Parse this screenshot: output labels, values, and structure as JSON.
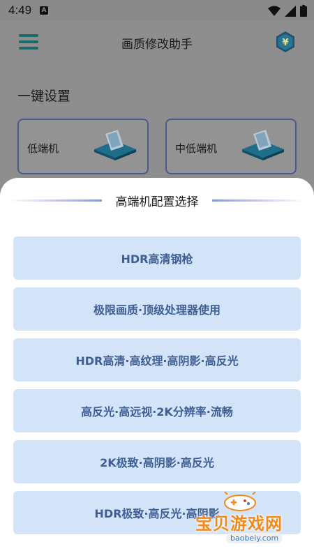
{
  "status_bar": {
    "time": "4:49",
    "notif_glyph": "A",
    "icons": [
      "wifi-icon",
      "signal-icon",
      "battery-icon"
    ]
  },
  "app": {
    "title": "画质修改助手",
    "menu_icon": "menu-icon",
    "right_icon": "yen-icon",
    "section_title": "一键设置",
    "tiers": [
      {
        "label": "低端机"
      },
      {
        "label": "中低端机"
      }
    ]
  },
  "sheet": {
    "title": "高端机配置选择",
    "options": [
      "HDR高清钢枪",
      "极限画质·顶级处理器使用",
      "HDR高清·高纹理·高阴影·高反光",
      "高反光·高远视·2K分辨率·流畅",
      "2K极致·高阴影·高反光",
      "HDR极致·高反光·高阴影"
    ]
  },
  "watermark": {
    "text": "宝贝游戏网",
    "url": "baobeiy.com"
  },
  "colors": {
    "accent": "#3e5f93",
    "option_bg": "#d4e4f8",
    "watermark": "#f08a1a"
  }
}
